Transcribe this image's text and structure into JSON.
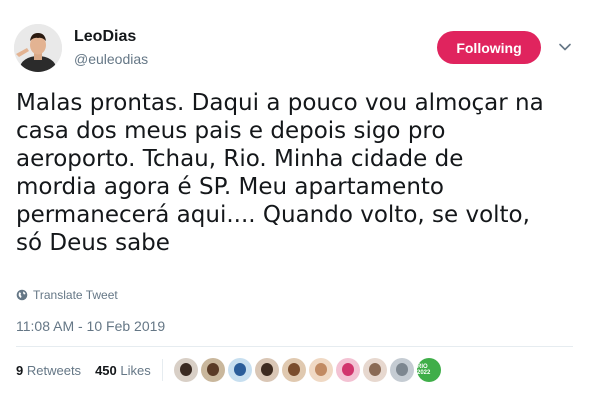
{
  "user": {
    "display_name": "LeoDias",
    "handle": "@euleodias",
    "avatar_icon": "profile-photo"
  },
  "follow_button": {
    "label": "Following",
    "color": "#e0245e"
  },
  "caret_icon": "chevron-down-icon",
  "tweet": {
    "lines": [
      "Malas prontas. Daqui a pouco vou almoçar na",
      "casa dos meus pais e depois sigo pro",
      "aeroporto. Tchau, Rio. Minha cidade de",
      "mordia agora é SP. Meu apartamento",
      "permanecerá aqui.... Quando volto, se volto,",
      "só Deus sabe"
    ],
    "translate_label": "Translate Tweet",
    "translate_icon": "globe-icon",
    "timestamp": "11:08 AM - 10 Feb 2019"
  },
  "stats": {
    "retweets_count": "9",
    "retweets_label": "Retweets",
    "likes_count": "450",
    "likes_label": "Likes"
  },
  "likers": [
    {
      "name": "liker-avatar-1",
      "bg": "#d8cfc6",
      "face": "#3a2a22"
    },
    {
      "name": "liker-avatar-2",
      "bg": "#c9b79c",
      "face": "#5a3b26"
    },
    {
      "name": "liker-avatar-3",
      "bg": "#c7dff0",
      "face": "#2a5d9a"
    },
    {
      "name": "liker-avatar-4",
      "bg": "#d9c6b5",
      "face": "#3d2a1f"
    },
    {
      "name": "liker-avatar-5",
      "bg": "#e0c9b0",
      "face": "#7a4d2d"
    },
    {
      "name": "liker-avatar-6",
      "bg": "#f0d9c4",
      "face": "#c18a62"
    },
    {
      "name": "liker-avatar-7",
      "bg": "#f3c2d3",
      "face": "#d1346d"
    },
    {
      "name": "liker-avatar-8",
      "bg": "#e7d8cf",
      "face": "#8a6a55"
    },
    {
      "name": "liker-avatar-9",
      "bg": "#c5ccd3",
      "face": "#7d8790"
    }
  ],
  "badge_liker": {
    "text": "RIO 2022",
    "bg": "#3fae49"
  }
}
